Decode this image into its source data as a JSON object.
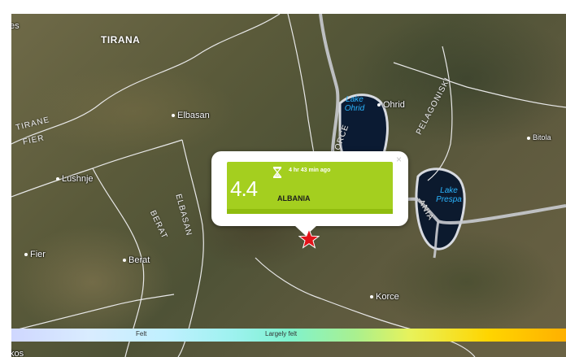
{
  "map": {
    "cities": [
      {
        "name": "TIRANA"
      },
      {
        "name": "Elbasan"
      },
      {
        "name": "Lushnje"
      },
      {
        "name": "Fier"
      },
      {
        "name": "Berat"
      },
      {
        "name": "Ohrid"
      },
      {
        "name": "Bitola"
      },
      {
        "name": "Korce"
      }
    ],
    "regions": [
      "TIRANE",
      "FIER",
      "ELBASAN",
      "BERAT",
      "PELAGONISKI",
      "KORCE",
      "ANIA"
    ],
    "lakes": [
      {
        "name": "Lake Ohrid"
      },
      {
        "name": "Lake Prespa"
      }
    ],
    "edge_labels": [
      "es",
      "kos"
    ]
  },
  "popup": {
    "magnitude": "4.4",
    "time_ago": "4 hr 43 min ago",
    "place": "ALBANIA",
    "close_symbol": "×",
    "card_color": "#a4cf1f",
    "card_dark_color": "#8fbc0e",
    "icon": "hourglass-icon"
  },
  "epicenter": {
    "icon": "star-icon",
    "color": "#e3131a"
  },
  "scale": {
    "labels": [
      "Felt",
      "Largely felt"
    ]
  }
}
